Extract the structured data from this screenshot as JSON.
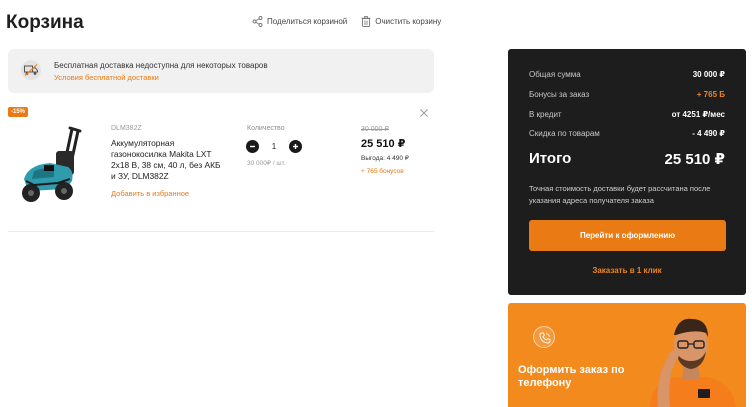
{
  "page": {
    "title": "Корзина"
  },
  "actions": {
    "share": "Поделиться корзиной",
    "clear": "Очистить корзину"
  },
  "notice": {
    "title": "Бесплатная доставка недоступна для некоторых товаров",
    "link": "Условия бесплатной доставки"
  },
  "item": {
    "discount_badge": "-15%",
    "sku": "DLM382Z",
    "name": "Аккумуляторная газонокосилка Makita LXT 2х18 В, 38 см, 40 л, без АКБ и ЗУ, DLM382Z",
    "favorite": "Добавить в избранное",
    "quantity_label": "Количество",
    "quantity": "1",
    "unit_price": "30 000₽ / шт.",
    "old_price": "30 000 ₽",
    "new_price": "25 510 ₽",
    "benefit": "Выгода: 4 490 ₽",
    "bonus": "+ 765 бонусов"
  },
  "summary": {
    "total_sum_label": "Общая сумма",
    "total_sum": "30 000 ₽",
    "bonus_label": "Бонусы за заказ",
    "bonus": "+ 765 Б",
    "credit_label": "В кредит",
    "credit": "от 4251 ₽/мес",
    "discount_label": "Скидка по товарам",
    "discount": "- 4 490 ₽",
    "grand_label": "Итого",
    "grand": "25 510 ₽",
    "delivery_note": "Точная стоимость доставки будет рассчитана после указания адреса получателя заказа",
    "checkout_button": "Перейти к оформлению",
    "one_click": "Заказать в 1 клик"
  },
  "promo": {
    "text": "Оформить заказ по телефону"
  },
  "colors": {
    "accent": "#ea7a14",
    "summary_bg": "#1d1d1d",
    "notice_bg": "#f1f1f1"
  }
}
